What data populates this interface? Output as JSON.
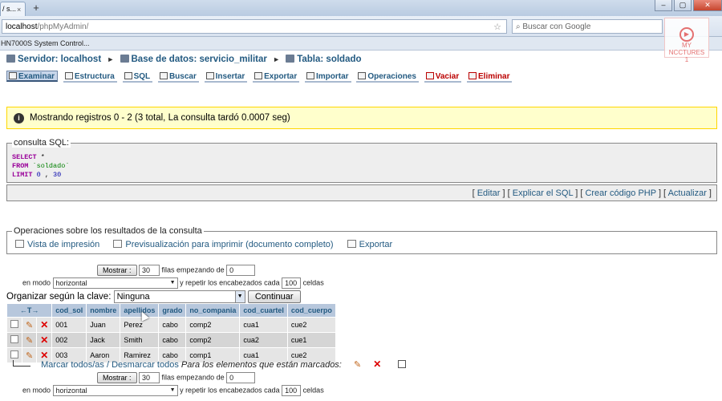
{
  "browser": {
    "tab_title": "/ s...",
    "tab_close": "×",
    "new_tab": "+",
    "url_host": "localhost",
    "url_path": "/phpMyAdmin/",
    "search_placeholder": "Buscar con Google",
    "bookmark": "HN7000S System Control..."
  },
  "watermark": {
    "line1": "MY",
    "line2": "NCCTURES",
    "line3": "1"
  },
  "breadcrumb": {
    "server": "Servidor: localhost",
    "database": "Base de datos: servicio_militar",
    "table": "Tabla: soldado",
    "sep": "►"
  },
  "tabs": [
    {
      "label": "Examinar",
      "icon": "browse-icon"
    },
    {
      "label": "Estructura",
      "icon": "structure-icon"
    },
    {
      "label": "SQL",
      "icon": "sql-icon"
    },
    {
      "label": "Buscar",
      "icon": "search-icon"
    },
    {
      "label": "Insertar",
      "icon": "insert-icon"
    },
    {
      "label": "Exportar",
      "icon": "export-icon"
    },
    {
      "label": "Importar",
      "icon": "import-icon"
    },
    {
      "label": "Operaciones",
      "icon": "operations-icon"
    },
    {
      "label": "Vaciar",
      "icon": "empty-icon"
    },
    {
      "label": "Eliminar",
      "icon": "drop-icon"
    }
  ],
  "notice": {
    "icon": "i",
    "text": "Mostrando registros 0 - 2 (3 total, La consulta tardó 0.0007 seg)"
  },
  "sql": {
    "legend": "consulta SQL:",
    "select": "SELECT",
    "star": " *",
    "from": "FROM",
    "table": " `soldado`",
    "limit": "LIMIT",
    "limit_a": " 0",
    "limit_sep": " , ",
    "limit_b": "30",
    "links": [
      "Editar",
      "Explicar el SQL",
      "Crear código PHP",
      "Actualizar"
    ]
  },
  "operations": {
    "legend": "Operaciones sobre los resultados de la consulta",
    "items": [
      "Vista de impresión",
      "Previsualización para imprimir (documento completo)",
      "Exportar"
    ]
  },
  "nav": {
    "show_button": "Mostrar :",
    "rows": "30",
    "rows_label": "filas empezando de",
    "start": "0",
    "mode_label": "en modo",
    "mode": "horizontal",
    "repeat_label": "y repetir los encabezados cada",
    "repeat": "100",
    "cells_label": "celdas"
  },
  "order": {
    "label": "Organizar según la clave:",
    "value": "Ninguna",
    "button": "Continuar"
  },
  "table": {
    "arrows": "←T→",
    "columns": [
      "cod_sol",
      "nombre",
      "apellidos",
      "grado",
      "no_compania",
      "cod_cuartel",
      "cod_cuerpo"
    ],
    "rows": [
      [
        "001",
        "Juan",
        "Perez",
        "cabo",
        "comp2",
        "cua1",
        "cue2"
      ],
      [
        "002",
        "Jack",
        "Smith",
        "cabo",
        "comp2",
        "cua2",
        "cue1"
      ],
      [
        "003",
        "Aaron",
        "Ramirez",
        "cabo",
        "comp1",
        "cua1",
        "cue2"
      ]
    ]
  },
  "mark": {
    "link": "Marcar todos/as / Desmarcar todos",
    "note": "Para los elementos que están marcados:"
  },
  "icons": {
    "edit": "✎",
    "delete": "✕"
  }
}
